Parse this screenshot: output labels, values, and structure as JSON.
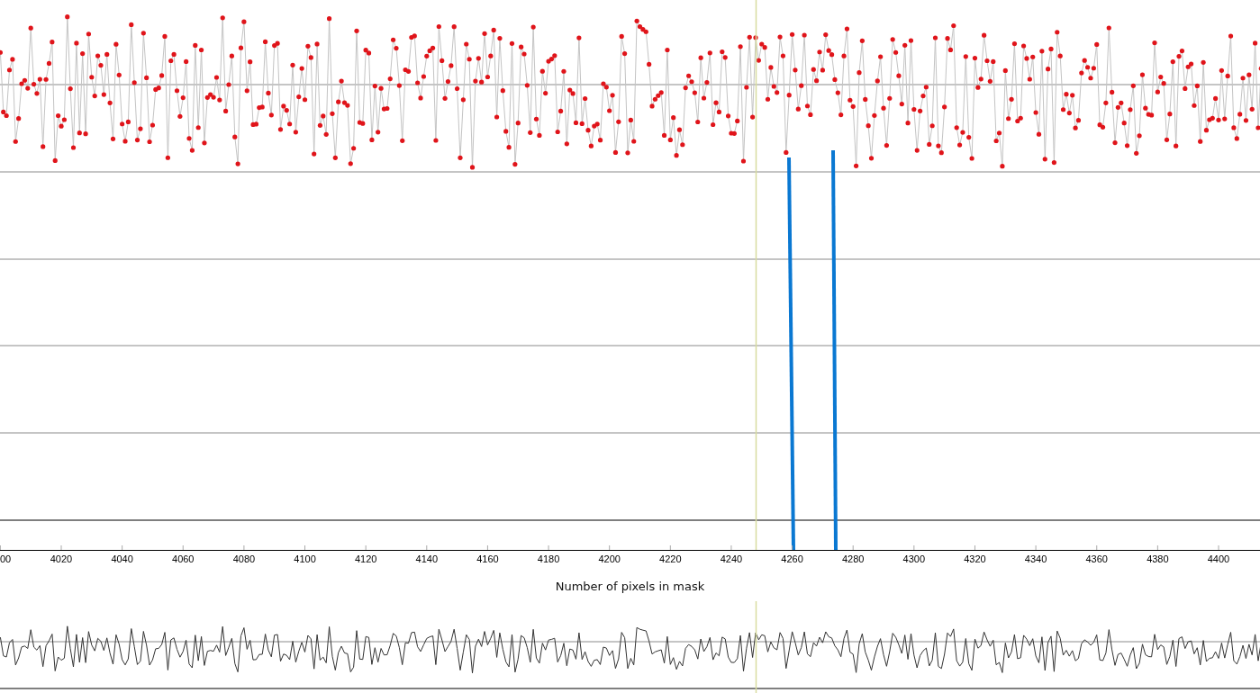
{
  "plot": {
    "x_tick_labels": [
      "00",
      "4020",
      "4040",
      "4060",
      "4080",
      "4100",
      "4120",
      "4140",
      "4160",
      "4180",
      "4200",
      "4220",
      "4240",
      "4260",
      "4280",
      "4300",
      "4320",
      "4340",
      "4360",
      "4380",
      "4400"
    ],
    "axis_title": "Number of pixels in mask"
  }
}
